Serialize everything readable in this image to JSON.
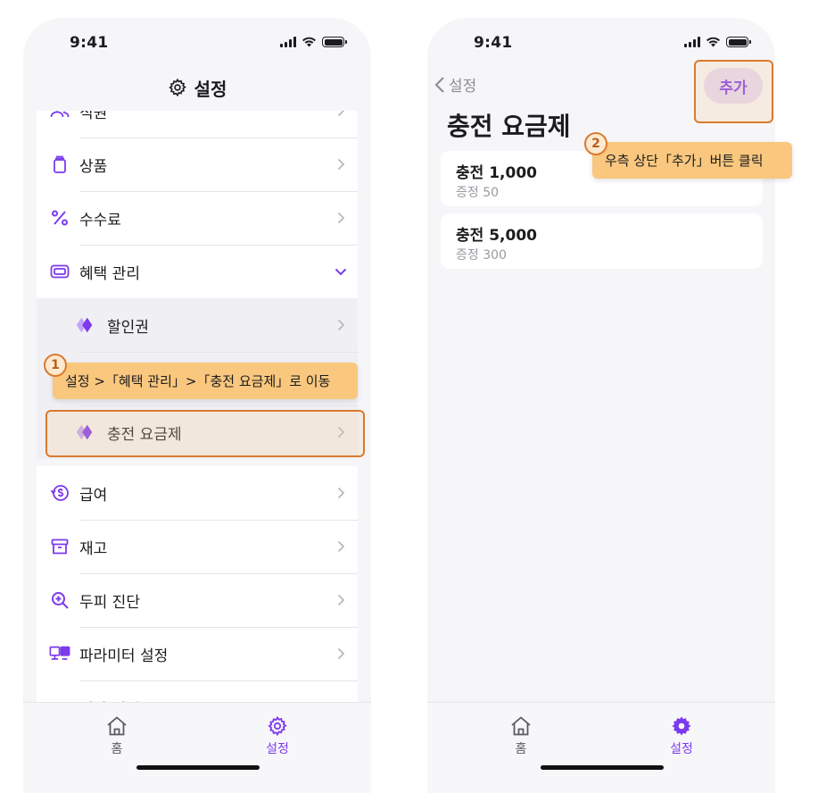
{
  "status_bar": {
    "time": "9:41"
  },
  "left_screen": {
    "header_title": "설정",
    "menu_items": [
      {
        "label": "직원",
        "icon": "users-icon"
      },
      {
        "label": "상품",
        "icon": "product-icon"
      },
      {
        "label": "수수료",
        "icon": "percent-icon"
      },
      {
        "label": "혜택 관리",
        "icon": "ticket-icon",
        "expanded": true
      },
      {
        "label": "할인권",
        "icon": "coupon-icon"
      },
      {
        "label": "",
        "icon": "coupon-icon"
      },
      {
        "label": "충전 요금제",
        "icon": "coupon-icon"
      },
      {
        "label": "급여",
        "icon": "salary-icon"
      },
      {
        "label": "재고",
        "icon": "inventory-icon"
      },
      {
        "label": "두피 진단",
        "icon": "scalp-diagnosis-icon"
      },
      {
        "label": "파라미터 설정",
        "icon": "parameter-icon"
      },
      {
        "label": "기타 설정",
        "icon": "etc-icon"
      }
    ],
    "tabs": [
      {
        "label": "홈",
        "icon": "home-icon"
      },
      {
        "label": "설정",
        "icon": "gear-icon"
      }
    ]
  },
  "right_screen": {
    "back_label": "설정",
    "add_button_label": "추가",
    "title": "충전 요금제",
    "plans": [
      {
        "name": "충전 1,000",
        "bonus": "증정 50"
      },
      {
        "name": "충전 5,000",
        "bonus": "증정 300"
      }
    ],
    "tabs": [
      {
        "label": "홈",
        "icon": "home-icon"
      },
      {
        "label": "설정",
        "icon": "gear-icon"
      }
    ]
  },
  "annotations": [
    {
      "step": "1",
      "text": "설정 >「혜택 관리」>「충전 요금제」로 이동"
    },
    {
      "step": "2",
      "text": "우측 상단「추가」버튼 클릭"
    }
  ],
  "colors": {
    "accent": "#7c3aed",
    "callout": "#f9c77e",
    "highlight_border": "#d97a2e"
  }
}
